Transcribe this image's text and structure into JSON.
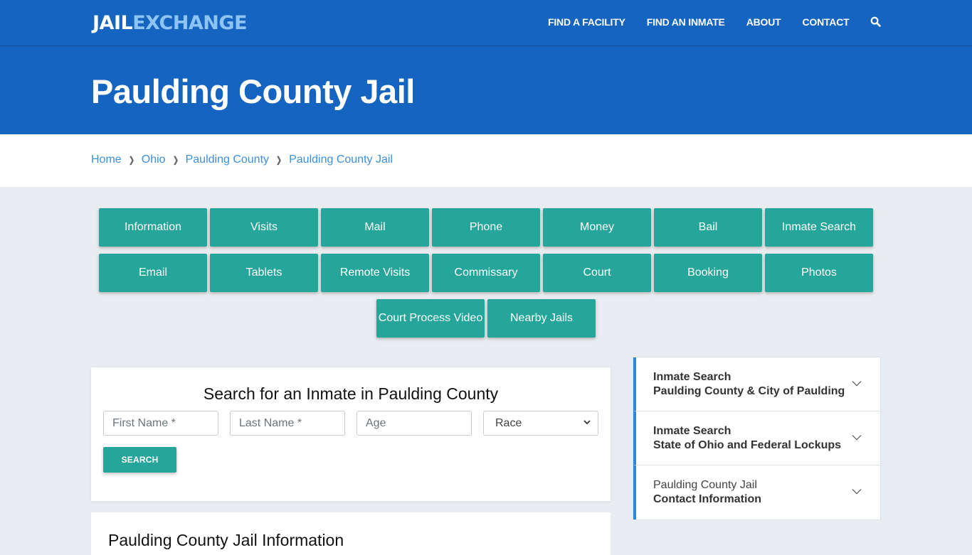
{
  "header": {
    "logo_part1": "JAIL",
    "logo_part2": "EXCHANGE",
    "nav": [
      "FIND A FACILITY",
      "FIND AN INMATE",
      "ABOUT",
      "CONTACT"
    ],
    "search_icon": "search-icon"
  },
  "hero": {
    "title": "Paulding County Jail"
  },
  "breadcrumb": [
    "Home",
    "Ohio",
    "Paulding County",
    "Paulding County Jail"
  ],
  "tiles": {
    "row1": [
      "Information",
      "Visits",
      "Mail",
      "Phone",
      "Money",
      "Bail",
      "Inmate Search"
    ],
    "row2": [
      "Email",
      "Tablets",
      "Remote Visits",
      "Commissary",
      "Court",
      "Booking",
      "Photos"
    ],
    "row3": [
      "Court Process Video",
      "Nearby Jails"
    ]
  },
  "search": {
    "title": "Search for an Inmate in Paulding County",
    "first_name_placeholder": "First Name *",
    "last_name_placeholder": "Last Name *",
    "age_placeholder": "Age",
    "race_selected": "Race",
    "button": "SEARCH"
  },
  "info": {
    "title": "Paulding County Jail Information"
  },
  "accordion": [
    {
      "line1": "Inmate Search",
      "line2": "Paulding County & City of Paulding",
      "line1_bold": true
    },
    {
      "line1": "Inmate Search",
      "line2": "State of Ohio and Federal Lockups",
      "line1_bold": true
    },
    {
      "line1": "Paulding County Jail",
      "line2": "Contact Information",
      "line1_bold": false
    }
  ],
  "colors": {
    "brand_blue": "#1565c0",
    "logo_accent": "#8cc4f5",
    "tile_teal": "#26a69a",
    "link_blue": "#3d8fd8",
    "accordion_accent": "#2a88d8"
  }
}
